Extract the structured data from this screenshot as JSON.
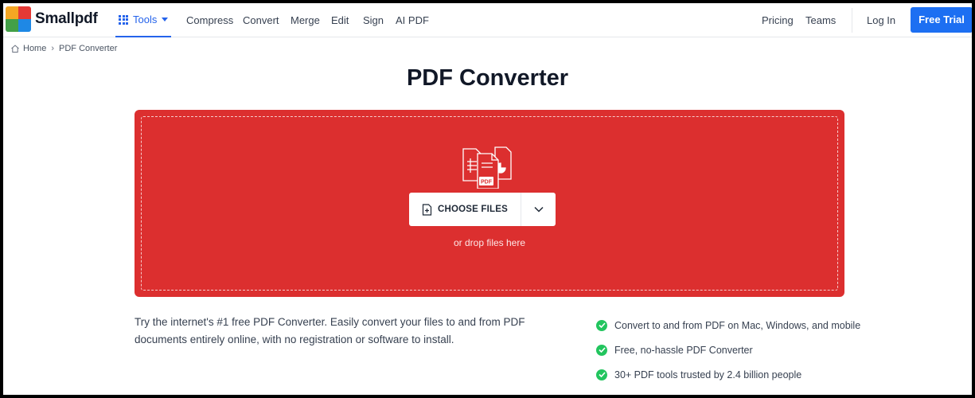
{
  "brand": {
    "name": "Smallpdf",
    "logo_colors": [
      "#f5a623",
      "#e53935",
      "#43a047",
      "#1e88e5"
    ]
  },
  "nav": {
    "tools_label": "Tools",
    "links": [
      "Compress",
      "Convert",
      "Merge",
      "Edit",
      "Sign",
      "AI PDF"
    ],
    "pricing": "Pricing",
    "teams": "Teams",
    "login": "Log In",
    "free_trial": "Free Trial"
  },
  "breadcrumb": {
    "home": "Home",
    "current": "PDF Converter"
  },
  "page_title": "PDF Converter",
  "dropzone": {
    "choose_label": "CHOOSE FILES",
    "drop_hint": "or drop files here",
    "badge": "PDF",
    "background": "#dc2f2f"
  },
  "description": "Try the internet's #1 free PDF Converter. Easily convert your files to and from PDF documents entirely online, with no registration or software to install.",
  "features": [
    "Convert to and from PDF on Mac, Windows, and mobile",
    "Free, no-hassle PDF Converter",
    "30+ PDF tools trusted by 2.4 billion people"
  ],
  "colors": {
    "accent": "#1d6ff2",
    "check": "#22c55e"
  }
}
